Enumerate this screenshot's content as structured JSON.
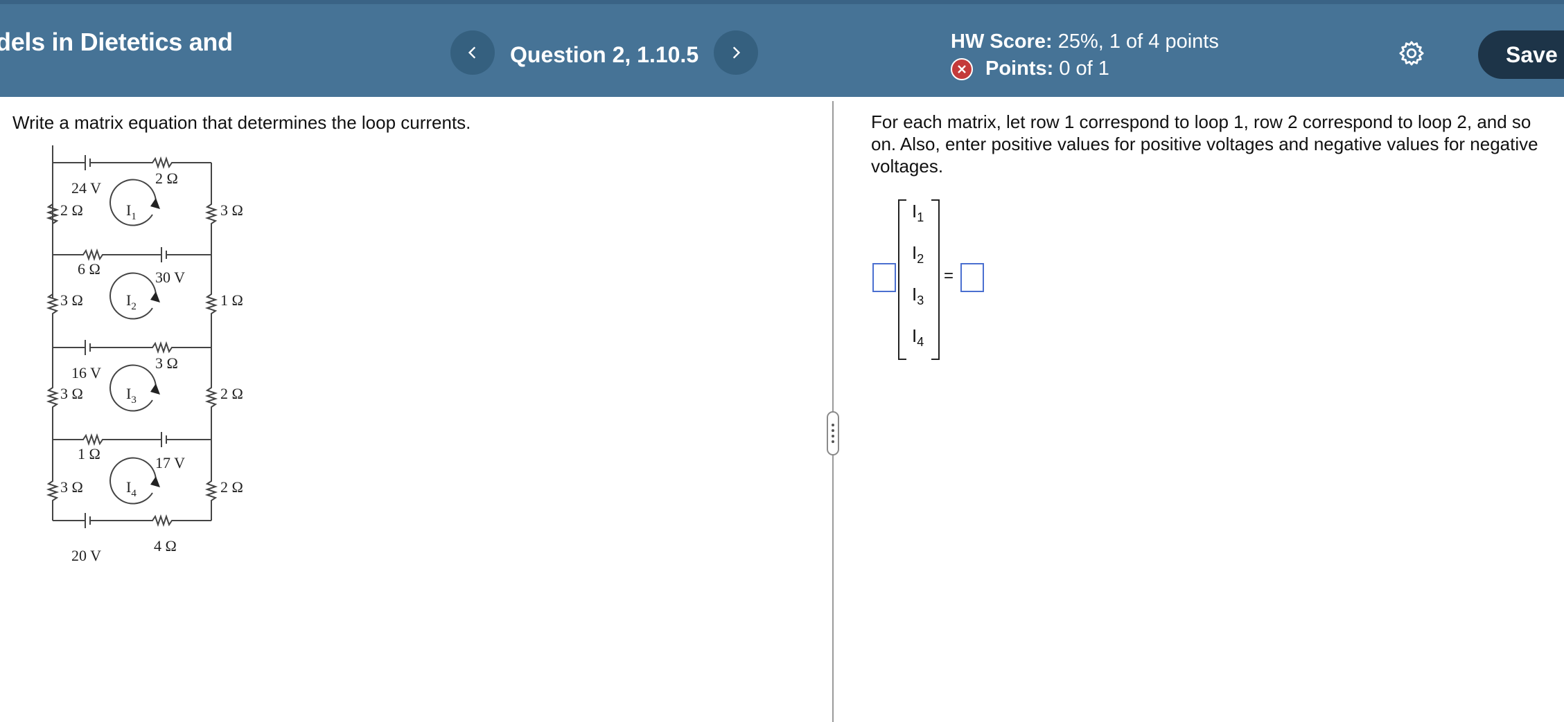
{
  "header": {
    "course_title": "dels in Dietetics and",
    "question_label": "Question 2, 1.10.5",
    "hw_score_label": "HW Score:",
    "hw_score_value": "25%, 1 of 4 points",
    "points_label": "Points:",
    "points_value": "0 of 1",
    "save_label": "Save",
    "prev_icon": "chevron-left-icon",
    "next_icon": "chevron-right-icon",
    "settings_icon": "gear-icon",
    "status_icon": "x-circle-icon"
  },
  "left_panel": {
    "prompt": "Write a matrix equation that determines the loop currents.",
    "circuit_labels": {
      "v1": "24 V",
      "r_top1": "2 Ω",
      "r_left1": "2 Ω",
      "r_right1": "3 Ω",
      "loop1": "I",
      "loop1_sub": "1",
      "r_mid1": "6 Ω",
      "v2": "30 V",
      "r_left2": "3 Ω",
      "r_right2": "1 Ω",
      "loop2": "I",
      "loop2_sub": "2",
      "r_mid2": "3 Ω",
      "v3": "16 V",
      "r_left3": "3 Ω",
      "r_right3": "2 Ω",
      "loop3": "I",
      "loop3_sub": "3",
      "r_mid3": "1 Ω",
      "v4": "17 V",
      "r_left4": "3 Ω",
      "r_right4": "2 Ω",
      "loop4": "I",
      "loop4_sub": "4",
      "v5": "20 V",
      "r_bottom": "4 Ω"
    }
  },
  "right_panel": {
    "instructions": "For each matrix, let row 1 correspond to loop 1, row 2 correspond to loop 2, and so on. Also, enter positive values for positive voltages and negative values for negative voltages.",
    "vector": [
      {
        "base": "I",
        "sub": "1"
      },
      {
        "base": "I",
        "sub": "2"
      },
      {
        "base": "I",
        "sub": "3"
      },
      {
        "base": "I",
        "sub": "4"
      }
    ],
    "equals": "=",
    "coefficient_matrix_value": "",
    "constant_vector_value": ""
  },
  "colors": {
    "header_bg": "#467396",
    "nav_button_bg": "#35607f",
    "save_bg": "#1d3448",
    "error_red": "#c43a3a",
    "input_border": "#4a6fd0"
  }
}
